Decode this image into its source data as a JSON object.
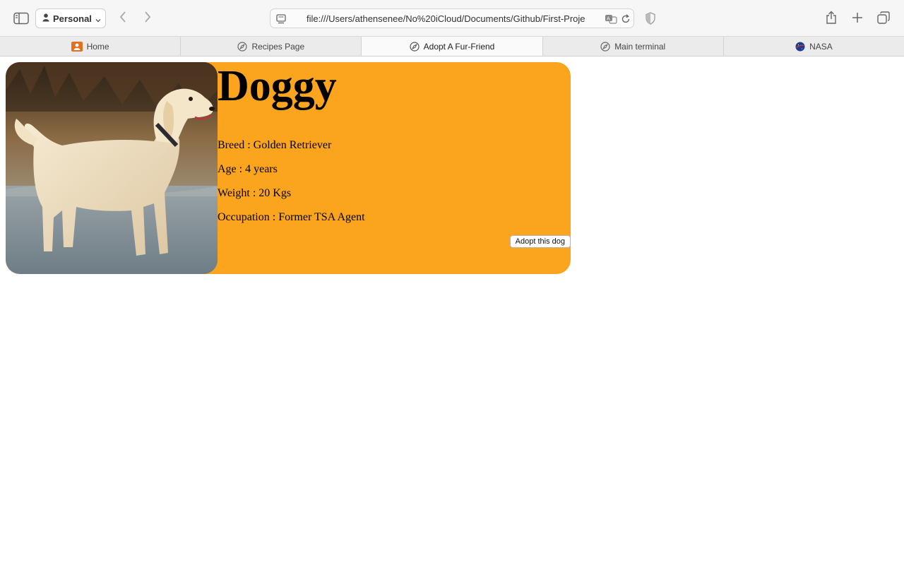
{
  "browser": {
    "profile_label": "Personal",
    "url": "file:///Users/athensenee/No%20iCloud/Documents/Github/First-Proje",
    "icons": {
      "sidebar": "sidebar-icon",
      "profile": "person-icon",
      "back": "chevron-left-icon",
      "forward": "chevron-right-icon",
      "page": "page-icon",
      "translate": "translate-icon",
      "reload": "reload-icon",
      "privacy": "shield-icon",
      "share": "share-icon",
      "new_tab": "plus-icon",
      "tab_overview": "tabs-overview-icon"
    }
  },
  "tabs": [
    {
      "label": "Home",
      "icon": "home-favicon-icon",
      "active": false
    },
    {
      "label": "Recipes Page",
      "icon": "compass-icon",
      "active": false
    },
    {
      "label": "Adopt A Fur-Friend",
      "icon": "compass-icon",
      "active": true
    },
    {
      "label": "Main terminal",
      "icon": "compass-icon",
      "active": false
    },
    {
      "label": "NASA",
      "icon": "nasa-favicon-icon",
      "active": false
    }
  ],
  "card": {
    "background_color": "#fba51f",
    "name": "Doggy",
    "breed": "Breed : Golden Retriever",
    "age": "Age : 4 years",
    "weight": "Weight : 20 Kgs",
    "occupation": "Occupation : Former TSA Agent",
    "adopt_button": "Adopt this dog",
    "photo_alt": "golden-retriever-photo"
  }
}
